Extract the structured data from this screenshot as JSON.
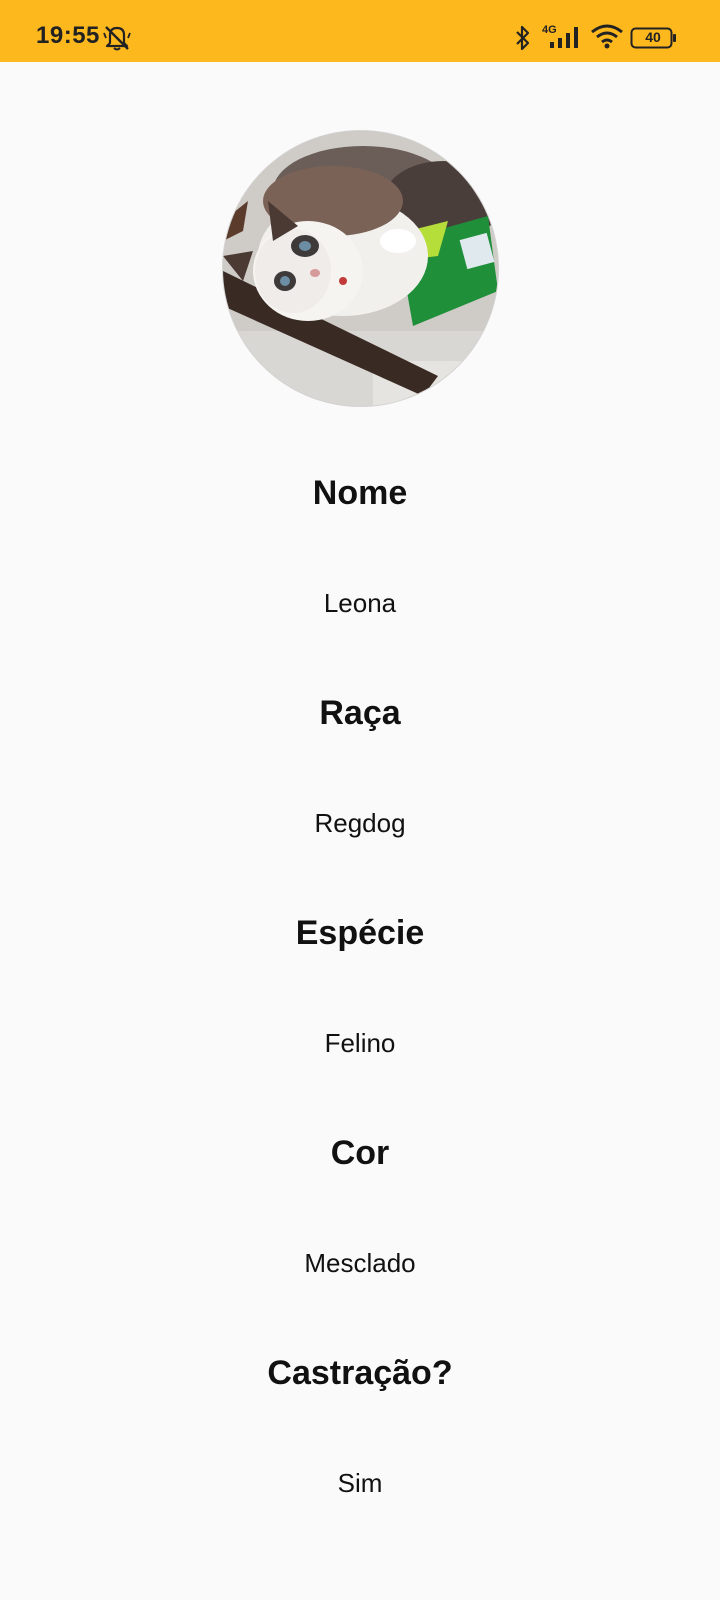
{
  "status_bar": {
    "time": "19:55",
    "network_type": "4G",
    "battery_level": "40",
    "background_color": "#fdb81e",
    "icons": [
      "mute-notification-icon",
      "bluetooth-icon",
      "cellular-signal-icon",
      "wifi-icon",
      "battery-icon"
    ]
  },
  "profile": {
    "photo_description_icon": "cat-photo",
    "fields": [
      {
        "label": "Nome",
        "value": "Leona"
      },
      {
        "label": "Raça",
        "value": "Regdog"
      },
      {
        "label": "Espécie",
        "value": "Felino"
      },
      {
        "label": "Cor",
        "value": "Mesclado"
      },
      {
        "label": "Castração?",
        "value": "Sim"
      }
    ]
  }
}
